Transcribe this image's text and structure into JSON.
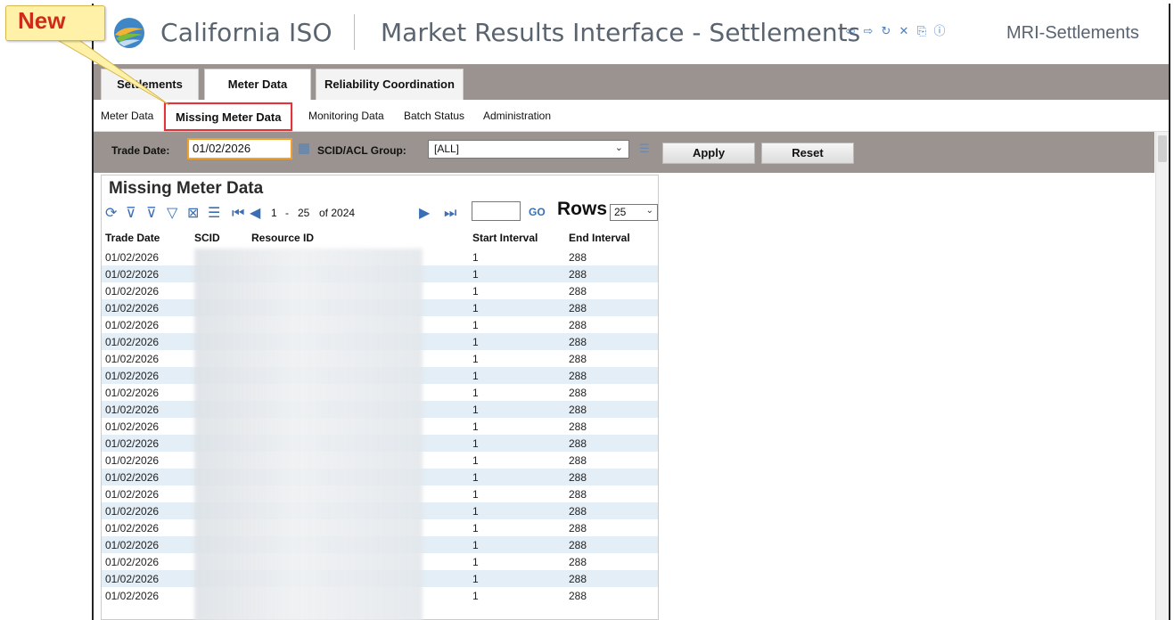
{
  "callout": {
    "text": "New"
  },
  "header": {
    "brand": "California ISO",
    "title": "Market Results Interface - Settlements",
    "app_name": "MRI-Settlements",
    "icons": [
      "back-icon",
      "forward-icon",
      "refresh-icon",
      "close-icon",
      "export-icon",
      "info-icon"
    ]
  },
  "tabs": [
    {
      "label": "Settlements",
      "active": false
    },
    {
      "label": "Meter Data",
      "active": true
    },
    {
      "label": "Reliability Coordination",
      "active": false
    }
  ],
  "subnav": [
    {
      "label": "Meter Data",
      "active": false
    },
    {
      "label": "Missing Meter Data",
      "active": true
    },
    {
      "label": "Monitoring Data",
      "active": false
    },
    {
      "label": "Batch Status",
      "active": false
    },
    {
      "label": "Administration",
      "active": false
    }
  ],
  "filters": {
    "trade_date_label": "Trade Date:",
    "trade_date_value": "01/02/2026",
    "scid_label": "SCID/ACL Group:",
    "scid_value": "[ALL]",
    "apply_label": "Apply",
    "reset_label": "Reset"
  },
  "panel": {
    "title": "Missing Meter Data",
    "page_start": "1",
    "page_sep": "-",
    "page_end": "25",
    "page_of": "of 2024",
    "go_label": "GO",
    "rows_label": "Rows",
    "rows_value": "25"
  },
  "grid": {
    "columns": [
      "Trade Date",
      "SCID",
      "Resource ID",
      "Start Interval",
      "End Interval"
    ],
    "rows": [
      [
        "01/02/2026",
        "",
        "",
        "1",
        "288"
      ],
      [
        "01/02/2026",
        "",
        "",
        "1",
        "288"
      ],
      [
        "01/02/2026",
        "",
        "",
        "1",
        "288"
      ],
      [
        "01/02/2026",
        "",
        "",
        "1",
        "288"
      ],
      [
        "01/02/2026",
        "",
        "",
        "1",
        "288"
      ],
      [
        "01/02/2026",
        "",
        "",
        "1",
        "288"
      ],
      [
        "01/02/2026",
        "",
        "",
        "1",
        "288"
      ],
      [
        "01/02/2026",
        "",
        "",
        "1",
        "288"
      ],
      [
        "01/02/2026",
        "",
        "",
        "1",
        "288"
      ],
      [
        "01/02/2026",
        "",
        "",
        "1",
        "288"
      ],
      [
        "01/02/2026",
        "",
        "",
        "1",
        "288"
      ],
      [
        "01/02/2026",
        "",
        "",
        "1",
        "288"
      ],
      [
        "01/02/2026",
        "",
        "",
        "1",
        "288"
      ],
      [
        "01/02/2026",
        "",
        "",
        "1",
        "288"
      ],
      [
        "01/02/2026",
        "",
        "",
        "1",
        "288"
      ],
      [
        "01/02/2026",
        "",
        "",
        "1",
        "288"
      ],
      [
        "01/02/2026",
        "",
        "",
        "1",
        "288"
      ],
      [
        "01/02/2026",
        "",
        "",
        "1",
        "288"
      ],
      [
        "01/02/2026",
        "",
        "",
        "1",
        "288"
      ],
      [
        "01/02/2026",
        "",
        "",
        "1",
        "288"
      ],
      [
        "01/02/2026",
        "",
        "",
        "1",
        "288"
      ]
    ]
  }
}
